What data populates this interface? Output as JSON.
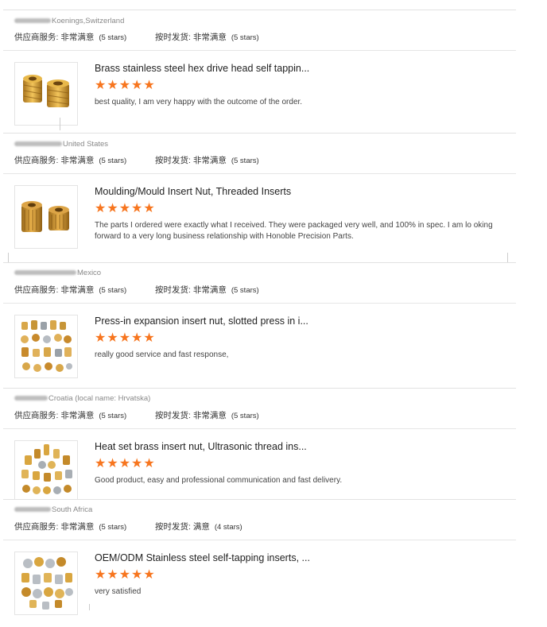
{
  "star_color": "#f7751e",
  "reviews": [
    {
      "country": "Koenings,Switzerland",
      "supplier_label": "供应商服务:",
      "supplier_value": "非常满意",
      "supplier_stars": "(5 stars)",
      "delivery_label": "按时发货:",
      "delivery_value": "非常满意",
      "delivery_stars": "(5 stars)",
      "product_title": "Brass stainless steel hex drive head self tappin...",
      "rating_stars": "★★★★★",
      "comment": "best quality, I am very happy with the outcome of the order."
    },
    {
      "country": "United States",
      "supplier_label": "供应商服务:",
      "supplier_value": "非常满意",
      "supplier_stars": "(5 stars)",
      "delivery_label": "按时发货:",
      "delivery_value": "非常满意",
      "delivery_stars": "(5 stars)",
      "product_title": "Moulding/Mould Insert Nut, Threaded Inserts",
      "rating_stars": "★★★★★",
      "comment": "The parts I ordered were exactly what I received.  They were packaged very well, and 100% in spec.  I am lo oking forward to a very long business relationship with Honoble Precision Parts."
    },
    {
      "country": "Mexico",
      "supplier_label": "供应商服务:",
      "supplier_value": "非常满意",
      "supplier_stars": "(5 stars)",
      "delivery_label": "按时发货:",
      "delivery_value": "非常满意",
      "delivery_stars": "(5 stars)",
      "product_title": "Press-in expansion insert nut, slotted press in i...",
      "rating_stars": "★★★★★",
      "comment": "really good service and fast response,"
    },
    {
      "country": "Croatia (local name: Hrvatska)",
      "supplier_label": "供应商服务:",
      "supplier_value": "非常满意",
      "supplier_stars": "(5 stars)",
      "delivery_label": "按时发货:",
      "delivery_value": "非常满意",
      "delivery_stars": "(5 stars)",
      "product_title": "Heat set brass insert nut, Ultrasonic thread ins...",
      "rating_stars": "★★★★★",
      "comment": "Good product, easy and professional communication and fast delivery."
    },
    {
      "country": "South Africa",
      "supplier_label": "供应商服务:",
      "supplier_value": "非常满意",
      "supplier_stars": "(5 stars)",
      "delivery_label": "按时发货:",
      "delivery_value": "满意",
      "delivery_stars": "(4 stars)",
      "product_title": "OEM/ODM Stainless steel self-tapping inserts, ...",
      "rating_stars": "★★★★★",
      "comment": "very satisfied"
    }
  ]
}
